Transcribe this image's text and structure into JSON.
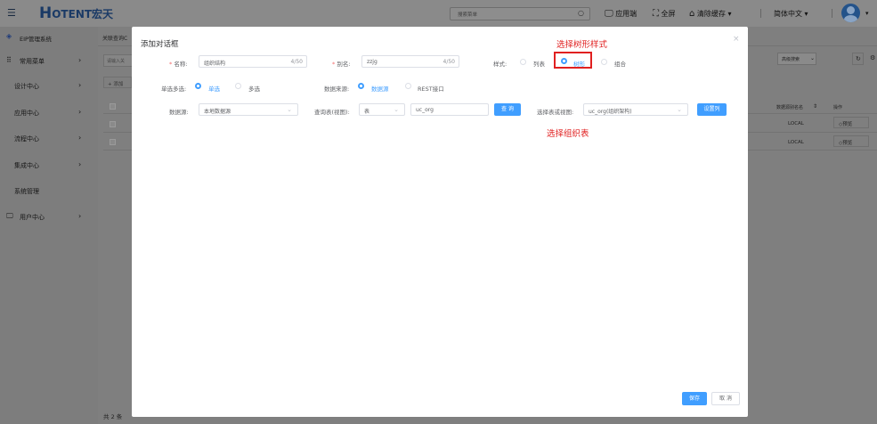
{
  "topbar": {
    "logo_letter": "H",
    "logo_text": "OTENT宏天",
    "search_placeholder": "搜索菜单",
    "app_label": "应用端",
    "fullscreen_label": "全屏",
    "clear_cache_label": "清除缓存",
    "language_label": "简体中文"
  },
  "sidebar": {
    "system_title": "EIP管理系统",
    "items": [
      {
        "label": "常用菜单"
      },
      {
        "label": "设计中心"
      },
      {
        "label": "应用中心"
      },
      {
        "label": "流程中心"
      },
      {
        "label": "集成中心"
      },
      {
        "label": "系统管理"
      },
      {
        "label": "用户中心"
      }
    ]
  },
  "background": {
    "tab_label": "关联查询C",
    "search_placeholder": "请输入关",
    "add_label": "+ 添加",
    "advanced_search_label": "高级搜索",
    "col_datasource": "数据源别名名",
    "col_action": "操作",
    "rows": [
      {
        "datasource": "LOCAL",
        "action": "◇预览"
      },
      {
        "datasource": "LOCAL",
        "action": "◇预览"
      }
    ],
    "total_label": "共 2 条"
  },
  "dialog": {
    "title": "添加对话框",
    "name_label": "名称:",
    "name_value": "组织结构",
    "name_count": "4/50",
    "alias_label": "别名:",
    "alias_value": "zzjg",
    "alias_count": "4/50",
    "style_label": "样式:",
    "style_options": [
      "列表",
      "树形",
      "组合"
    ],
    "select_mode_label": "单选多选:",
    "select_mode_options": [
      "单选",
      "多选"
    ],
    "data_source_type_label": "数据来源:",
    "data_source_type_options": [
      "数据源",
      "REST接口"
    ],
    "datasource_label": "数据源:",
    "datasource_value": "本地数据源",
    "query_table_label": "查询表(视图):",
    "query_type_value": "表",
    "query_table_value": "uc_org",
    "query_button": "查 询",
    "select_table_label": "选择表或视图:",
    "select_table_value": "uc_org(组织架构)",
    "set_columns_button": "设置列",
    "save_button": "保存",
    "cancel_button": "取 消"
  },
  "annotations": {
    "tree_style": "选择树形样式",
    "org_table": "选择组织表"
  },
  "colors": {
    "primary": "#409eff",
    "annotation": "#e02020",
    "overlay": "#7f7f7f"
  }
}
